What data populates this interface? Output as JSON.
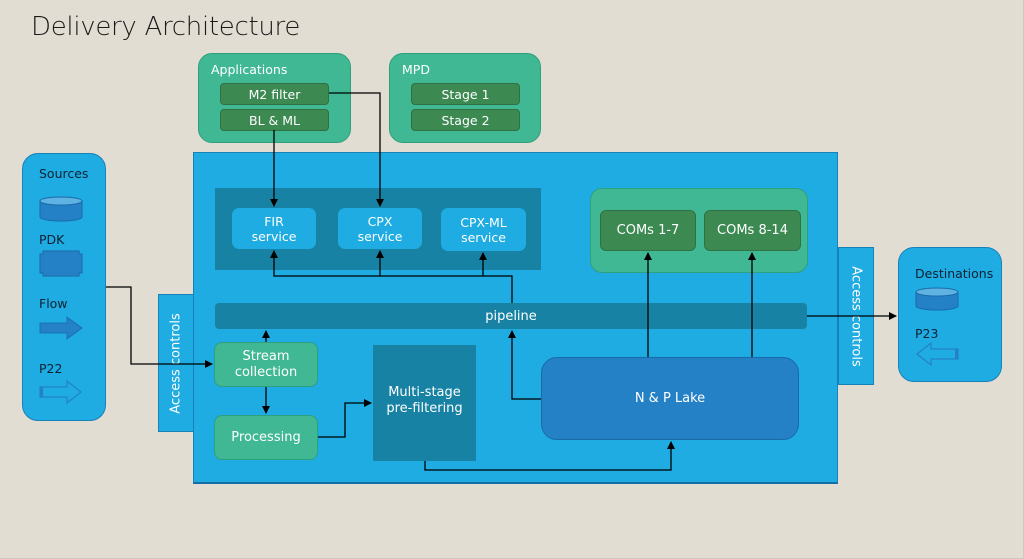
{
  "title": "Delivery Architecture",
  "applications": {
    "label": "Applications",
    "items": [
      "M2 filter",
      "BL & ML"
    ]
  },
  "mpd": {
    "label": "MPD",
    "items": [
      "Stage 1",
      "Stage 2"
    ]
  },
  "sources_panel": {
    "items": [
      {
        "label": "Sources",
        "icon": "database-cylinder-icon"
      },
      {
        "label": "PDK",
        "icon": "notched-rectangle-icon"
      },
      {
        "label": "Flow",
        "icon": "solid-right-arrow-icon"
      },
      {
        "label": "P22",
        "icon": "outline-right-arrow-icon"
      }
    ]
  },
  "destinations_panel": {
    "items": [
      {
        "label": "Destinations",
        "icon": "database-cylinder-icon"
      },
      {
        "label": "P23",
        "icon": "outline-left-arrow-icon"
      }
    ]
  },
  "access_controls": {
    "left": "Access controls",
    "right": "Access controls"
  },
  "services": [
    {
      "line1": "FIR",
      "line2": "service"
    },
    {
      "line1": "CPX",
      "line2": "service"
    },
    {
      "line1": "CPX-ML",
      "line2": "service"
    }
  ],
  "coms": [
    "COMs 1-7",
    "COMs 8-14"
  ],
  "pipeline": "pipeline",
  "stream_collection": {
    "line1": "Stream",
    "line2": "collection"
  },
  "processing": "Processing",
  "multistage": {
    "line1": "Multi-stage",
    "line2": "pre-filtering"
  },
  "lake": "N & P Lake",
  "colors": {
    "background": "#e2ddd2",
    "main_blue": "#1eace2",
    "dark_teal": "#1782a3",
    "green": "#40b894",
    "dark_green": "#3c8a52",
    "lake_blue": "#2581c6"
  }
}
